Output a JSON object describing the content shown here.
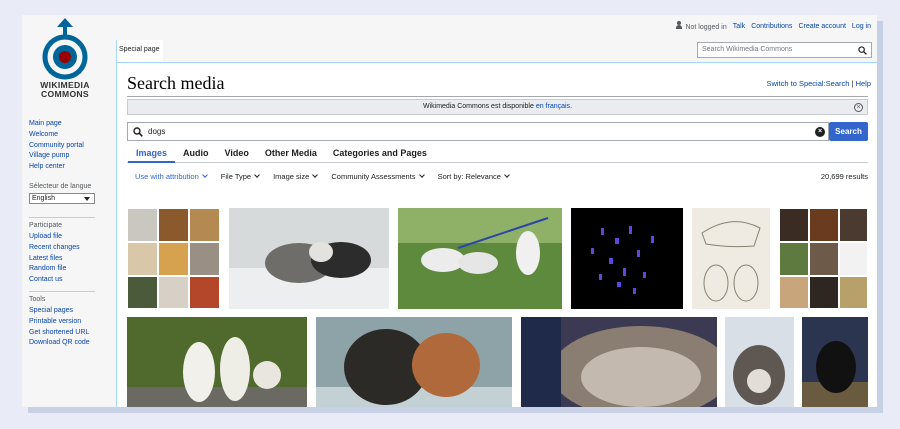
{
  "logo": {
    "line1": "WIKIMEDIA",
    "line2": "COMMONS"
  },
  "sidebar": {
    "nav": [
      "Main page",
      "Welcome",
      "Community portal",
      "Village pump",
      "Help center"
    ],
    "language_heading": "Sélecteur de langue",
    "language_value": "English",
    "participate_heading": "Participate",
    "participate": [
      "Upload file",
      "Recent changes",
      "Latest files",
      "Random file",
      "Contact us"
    ],
    "tools_heading": "Tools",
    "tools": [
      "Special pages",
      "Printable version",
      "Get shortened URL",
      "Download QR code"
    ]
  },
  "top": {
    "not_logged": "Not logged in",
    "links": [
      "Talk",
      "Contributions",
      "Create account",
      "Log in"
    ],
    "tab_special": "Special page",
    "search_placeholder": "Search Wikimedia Commons"
  },
  "page": {
    "title": "Search media",
    "switch_link": "Switch to Special:Search",
    "sep": "|",
    "help_link": "Help"
  },
  "notice": {
    "text": "Wikimedia Commons est disponible ",
    "link": "en français",
    "tail": "."
  },
  "search": {
    "query": "dogs",
    "button": "Search"
  },
  "tabs": [
    {
      "label": "Images",
      "active": true
    },
    {
      "label": "Audio",
      "active": false
    },
    {
      "label": "Video",
      "active": false
    },
    {
      "label": "Other Media",
      "active": false
    },
    {
      "label": "Categories and Pages",
      "active": false
    }
  ],
  "filters": [
    "Use with attribution",
    "File Type",
    "Image size",
    "Community Assessments",
    "Sort by: Relevance"
  ],
  "results_count": "20,699 results",
  "icons": [
    "user-icon",
    "search-icon",
    "close-icon",
    "chevron-down-icon"
  ],
  "colors": {
    "accent": "#3366cc",
    "link": "#0645ad"
  }
}
